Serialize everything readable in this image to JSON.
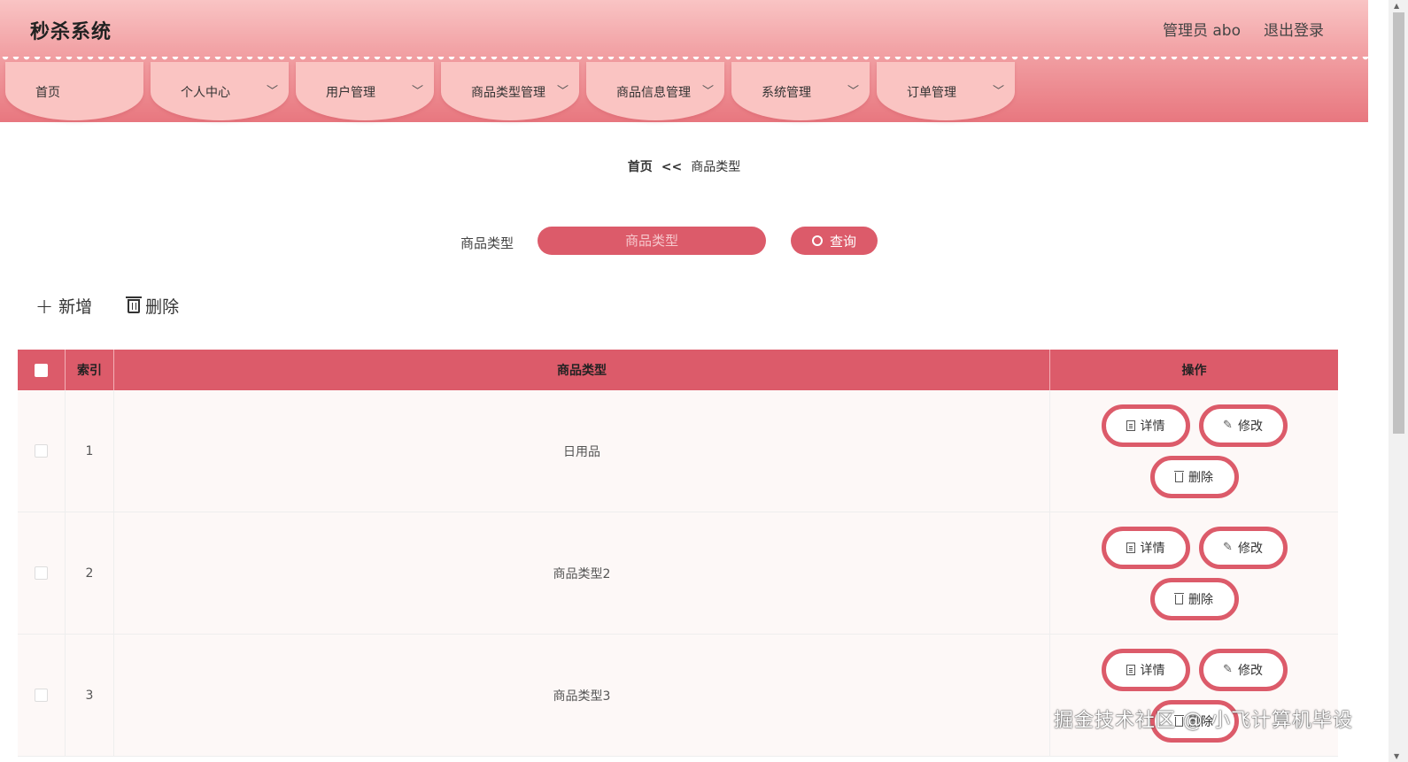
{
  "app": {
    "title": "秒杀系统"
  },
  "user": {
    "admin_label": "管理员 abo",
    "logout_label": "退出登录"
  },
  "nav": [
    {
      "label": "首页",
      "has_dropdown": false
    },
    {
      "label": "个人中心",
      "has_dropdown": true
    },
    {
      "label": "用户管理",
      "has_dropdown": true
    },
    {
      "label": "商品类型管理",
      "has_dropdown": true
    },
    {
      "label": "商品信息管理",
      "has_dropdown": true
    },
    {
      "label": "系统管理",
      "has_dropdown": true
    },
    {
      "label": "订单管理",
      "has_dropdown": true
    }
  ],
  "breadcrumb": {
    "home": "首页",
    "separator": "<<",
    "current": "商品类型"
  },
  "search": {
    "label": "商品类型",
    "placeholder": "商品类型",
    "button_label": "查询"
  },
  "toolbar": {
    "add_label": "新增",
    "delete_label": "删除"
  },
  "table": {
    "headers": {
      "index": "索引",
      "type": "商品类型",
      "ops": "操作"
    },
    "rows": [
      {
        "index": "1",
        "type": "日用品"
      },
      {
        "index": "2",
        "type": "商品类型2"
      },
      {
        "index": "3",
        "type": "商品类型3"
      }
    ],
    "op_labels": {
      "detail": "详情",
      "edit": "修改",
      "delete": "删除"
    }
  },
  "watermark": "掘金技术社区 @ 小飞计算机毕设",
  "colors": {
    "accent": "#dc5b6a",
    "nav_tab": "#fac4c2",
    "header_top": "#f9c4c4"
  },
  "icons": {
    "search": "search-icon",
    "add": "plus-icon",
    "delete": "trash-icon",
    "detail": "document-icon",
    "edit": "pencil-icon",
    "dropdown": "chevron-down-icon"
  }
}
